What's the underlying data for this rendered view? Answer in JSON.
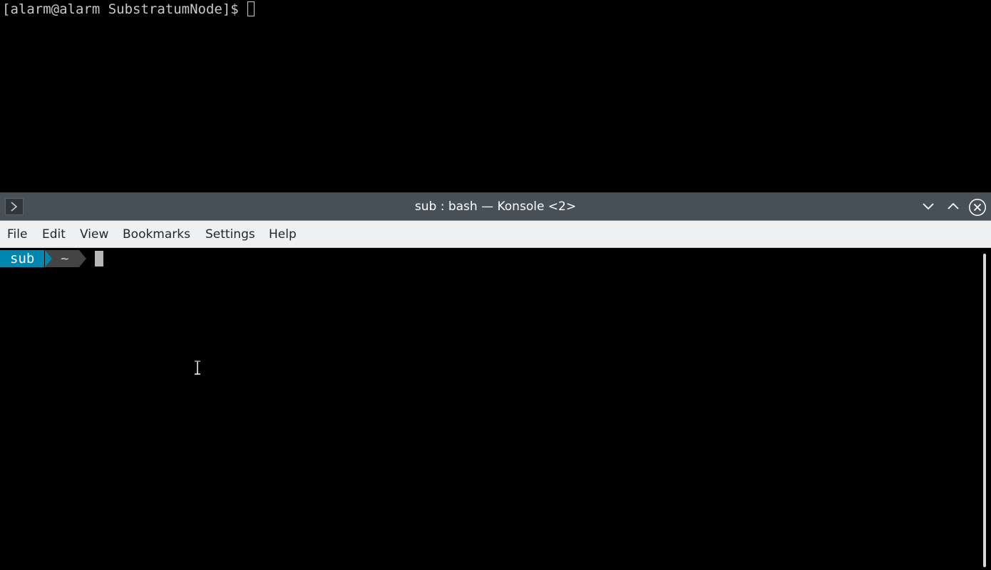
{
  "background_terminal": {
    "prompt": "[alarm@alarm SubstratumNode]$"
  },
  "window": {
    "title": "sub : bash — Konsole <2>",
    "app_icon": "terminal-icon",
    "controls": [
      "minimize-icon",
      "maximize-icon",
      "close-icon"
    ],
    "accent_color": "#3daee9"
  },
  "menubar": {
    "items": [
      "File",
      "Edit",
      "View",
      "Bookmarks",
      "Settings",
      "Help"
    ]
  },
  "terminal": {
    "prompt_user": "sub",
    "prompt_dir": "~",
    "user_segment_color": "#0087af",
    "dir_segment_color": "#444444"
  }
}
